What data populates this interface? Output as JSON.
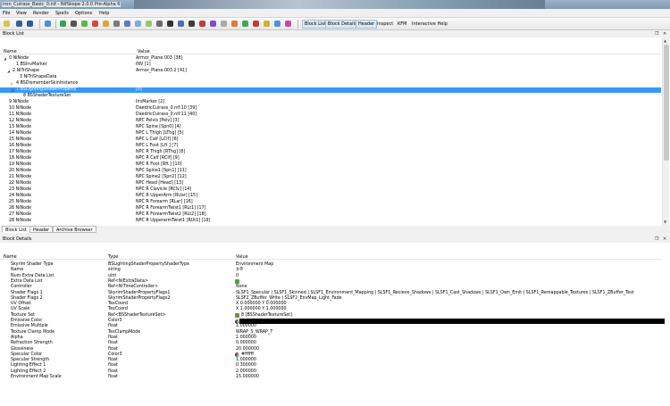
{
  "window": {
    "title": "Iron_Cuirass_Basic_0.nif - NifSkope 2.0.0 Pre-Alpha 6"
  },
  "menu": [
    "File",
    "View",
    "Render",
    "Spells",
    "Options",
    "Help"
  ],
  "toolbar": {
    "block_list": "Block List",
    "block_details": "Block Details",
    "header": "Header",
    "inspect": "Inspect",
    "kfm": "KFM",
    "interactive_help": "Interactive Help"
  },
  "block_list": {
    "title": "Block List",
    "columns": {
      "name": "Name",
      "value": "Value"
    },
    "rows": [
      {
        "name": "0 NiNode",
        "value": "Armor_Plane.003 [38]",
        "expand": "◢",
        "indent": 0
      },
      {
        "name": "1 BSInvMarker",
        "value": "INV [1]",
        "indent": 2
      },
      {
        "name": "2 NiTriShape",
        "value": "Armor_Plane.003.2 [41]",
        "expand": "◢",
        "indent": 1
      },
      {
        "name": "3 NiTriShapeData",
        "value": "",
        "indent": 3
      },
      {
        "name": "4 BSDismemberSkinInstance",
        "value": "",
        "expand": "▷",
        "indent": 2
      },
      {
        "name": "7 BSLightingShaderProperty",
        "value": "[0]",
        "expand": "◢",
        "indent": 2,
        "selected": true
      },
      {
        "name": "8 BSShaderTextureSet",
        "value": "",
        "indent": 4
      },
      {
        "name": "9 NiNode",
        "value": "InvMarker [2]",
        "indent": 0
      },
      {
        "name": "10 NiNode",
        "value": "DaedricCuirass_0.nif:10 [39]",
        "indent": 0
      },
      {
        "name": "11 NiNode",
        "value": "DaedricCuirass_0.nif:11 [40]",
        "indent": 0
      },
      {
        "name": "12 NiNode",
        "value": "NPC Pelvis [Pelv] [3]",
        "indent": 0
      },
      {
        "name": "13 NiNode",
        "value": "NPC Spine [Spn0] [4]",
        "indent": 0
      },
      {
        "name": "14 NiNode",
        "value": "NPC L Thigh [LThg] [5]",
        "indent": 0
      },
      {
        "name": "15 NiNode",
        "value": "NPC L Calf [LClf] [6]",
        "indent": 0
      },
      {
        "name": "16 NiNode",
        "value": "NPC L Foot [Lft ] [7]",
        "indent": 0
      },
      {
        "name": "17 NiNode",
        "value": "NPC R Thigh [RThg] [8]",
        "indent": 0
      },
      {
        "name": "18 NiNode",
        "value": "NPC R Calf [RClf] [9]",
        "indent": 0
      },
      {
        "name": "19 NiNode",
        "value": "NPC R Foot [Rft ] [10]",
        "indent": 0
      },
      {
        "name": "20 NiNode",
        "value": "NPC Spine1 [Spn1] [11]",
        "indent": 0
      },
      {
        "name": "21 NiNode",
        "value": "NPC Spine2 [Spn2] [12]",
        "indent": 0
      },
      {
        "name": "22 NiNode",
        "value": "NPC Head [Head] [13]",
        "indent": 0
      },
      {
        "name": "23 NiNode",
        "value": "NPC R Clavicle [RClv] [14]",
        "indent": 0
      },
      {
        "name": "24 NiNode",
        "value": "NPC R UpperArm [RUar] [15]",
        "indent": 0
      },
      {
        "name": "25 NiNode",
        "value": "NPC R Forearm [RLar] [16]",
        "indent": 0
      },
      {
        "name": "26 NiNode",
        "value": "NPC R ForearmTwist1 [RLt1] [17]",
        "indent": 0
      },
      {
        "name": "27 NiNode",
        "value": "NPC R ForearmTwist2 [RLt2] [18]",
        "indent": 0
      },
      {
        "name": "28 NiNode",
        "value": "NPC R UpperarmTwist1 [RUt1] [19]",
        "indent": 0
      }
    ]
  },
  "tabs": [
    "Block List",
    "Header",
    "Archive Browser"
  ],
  "block_details": {
    "title": "Block Details",
    "columns": {
      "name": "Name",
      "type": "Type",
      "value": "Value"
    },
    "rows": [
      {
        "name": "Skyrim Shader Type",
        "type": "BSLightingShaderPropertyShaderType",
        "value": "Environment Map"
      },
      {
        "name": "Name",
        "type": "string",
        "value": "±®"
      },
      {
        "name": "Num Extra Data List",
        "type": "uint",
        "value": "0"
      },
      {
        "name": "Extra Data List",
        "type": "Ref<NiExtraData>",
        "value": ""
      },
      {
        "name": "Controller",
        "type": "Ref<NiTimeController>",
        "value": "None"
      },
      {
        "name": "Shader Flags 1",
        "type": "SkyrimShaderPropertyFlags1",
        "value": "SLSF1_Specular | SLSF1_Skinned | SLSF1_Environment_Mapping | SLSF1_Recieve_Shadows | SLSF1_Cast_Shadows | SLSF1_Own_Emit | SLSF1_Remappable_Textures | SLSF1_ZBuffer_Test"
      },
      {
        "name": "Shader Flags 2",
        "type": "SkyrimShaderPropertyFlags2",
        "value": "SLSF2_ZBuffer_Write | SLSF2_EnvMap_Light_Fade"
      },
      {
        "name": "UV Offset",
        "type": "TexCoord",
        "value": "X 0.000000 Y 0.000000"
      },
      {
        "name": "UV Scale",
        "type": "TexCoord",
        "value": "X 1.000000 Y 1.000000"
      },
      {
        "name": "Texture Set",
        "type": "Ref<BSShaderTextureSet>",
        "value": "8 [BSShaderTextureSet]"
      },
      {
        "name": "Emissive Color",
        "type": "Color3",
        "value": "",
        "black": true
      },
      {
        "name": "Emissive Multiple",
        "type": "float",
        "value": "1.000000"
      },
      {
        "name": "Texture Clamp Mode",
        "type": "TexClampMode",
        "value": "WRAP_S_WRAP_T"
      },
      {
        "name": "Alpha",
        "type": "float",
        "value": "1.000000"
      },
      {
        "name": "Refraction Strength",
        "type": "float",
        "value": "0.000000"
      },
      {
        "name": "Glossiness",
        "type": "float",
        "value": "20.000000"
      },
      {
        "name": "Specular Color",
        "type": "Color3",
        "value": "#ffffff",
        "swatch": true
      },
      {
        "name": "Specular Strength",
        "type": "float",
        "value": "1.000000"
      },
      {
        "name": "Lighting Effect 1",
        "type": "float",
        "value": "0.300000"
      },
      {
        "name": "Lighting Effect 2",
        "type": "float",
        "value": "2.000000"
      },
      {
        "name": "Environment Map Scale",
        "type": "float",
        "value": "15.000000"
      }
    ]
  },
  "colors": {
    "selection": "#3399ff",
    "accent": "#6f8298"
  }
}
